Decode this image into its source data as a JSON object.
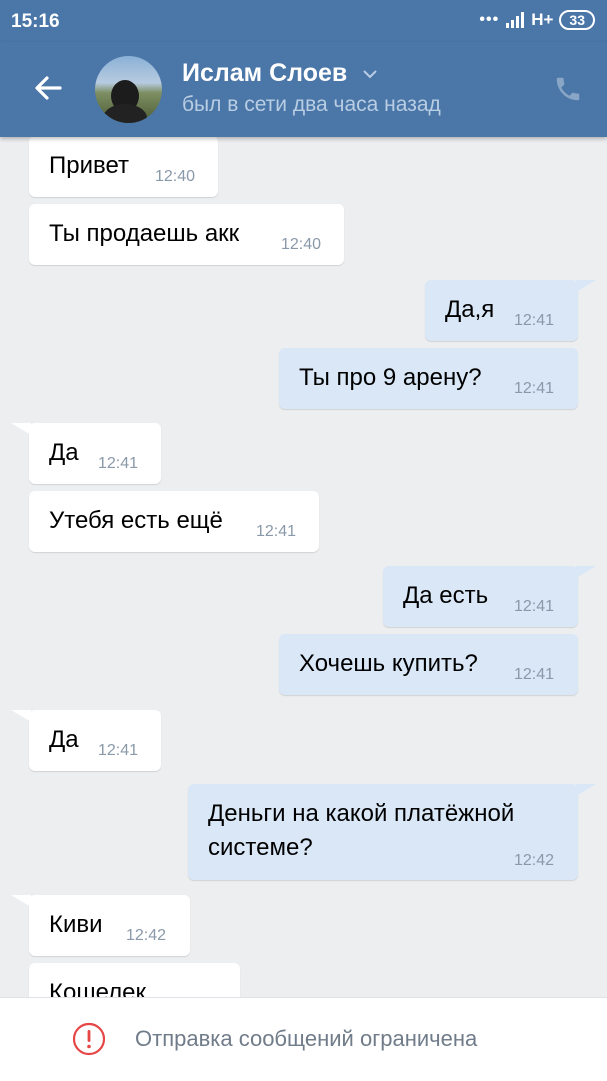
{
  "status_bar": {
    "time": "15:16",
    "network": "H+",
    "battery": "33"
  },
  "header": {
    "name": "Ислам Слоев",
    "last_seen": "был в сети два часа назад"
  },
  "messages": [
    {
      "dir": "in",
      "text": "Привет",
      "time": "12:40"
    },
    {
      "dir": "in",
      "text": "Ты продаешь акк",
      "time": "12:40"
    },
    {
      "dir": "out",
      "text": "Да,я",
      "time": "12:41"
    },
    {
      "dir": "out",
      "text": "Ты про 9 арену?",
      "time": "12:41"
    },
    {
      "dir": "in",
      "text": "Да",
      "time": "12:41"
    },
    {
      "dir": "in",
      "text": "Утебя есть ещё",
      "time": "12:41"
    },
    {
      "dir": "out",
      "text": "Да есть",
      "time": "12:41"
    },
    {
      "dir": "out",
      "text": "Хочешь купить?",
      "time": "12:41"
    },
    {
      "dir": "in",
      "text": "Да",
      "time": "12:41"
    },
    {
      "dir": "out",
      "text": "Деньги на какой платёжной\nсистеме?",
      "time": "12:42"
    },
    {
      "dir": "in",
      "text": "Киви",
      "time": "12:42"
    },
    {
      "dir": "in",
      "text": "Кошелек",
      "time": ""
    }
  ],
  "footer": {
    "text": "Отправка сообщений ограничена",
    "icon": "warning-circle-icon",
    "accent": "#e64646"
  },
  "colors": {
    "header": "#4a76a8",
    "outgoing_bubble": "#d9e7f7",
    "incoming_bubble": "#ffffff",
    "background": "#edeef0"
  }
}
